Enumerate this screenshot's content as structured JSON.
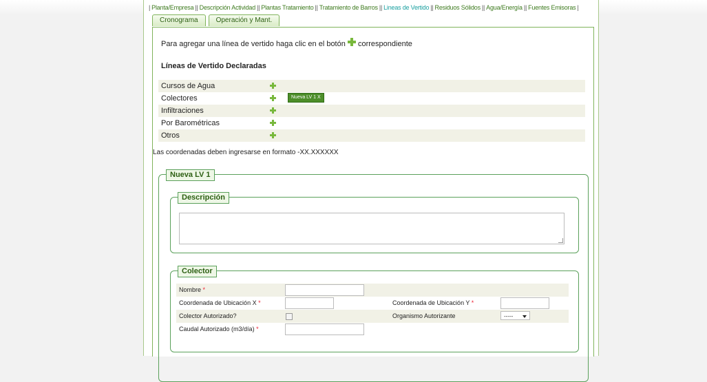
{
  "nav": {
    "items": [
      "Planta/Empresa",
      "Descripción Actividad",
      "Plantas Tratamiento",
      "Tratamiento de Barros",
      "Lineas de Vertido",
      "Residuos Sólidos",
      "Agua/Energía",
      "Fuentes Emisoras"
    ]
  },
  "tabs": [
    "Cronograma",
    "Operación y Mant."
  ],
  "instructions": {
    "before": "Para agregar una línea de vertido haga clic en el botón",
    "after": "correspondiente"
  },
  "declared_title": "Líneas de Vertido Declaradas",
  "lineas": [
    "Cursos de Agua",
    "Colectores",
    "Infiltraciones",
    "Por Barométricas",
    "Otros"
  ],
  "tag_label": "Nueva LV 1  X",
  "coord_note": "Las coordenadas deben ingresarse en formato -XX.XXXXXX",
  "lv_legend": "Nueva LV 1",
  "desc_legend": "Descripción",
  "colector_legend": "Colector",
  "form": {
    "nombre": "Nombre",
    "coord_x": "Coordenada de Ubicación X",
    "coord_y": "Coordenada de Ubicación Y",
    "autorizado": "Colector Autorizado?",
    "organismo": "Organismo Autorizante",
    "organismo_value": "-----",
    "caudal": "Caudal Autorizado (m3/día)",
    "required_mark": "*"
  }
}
